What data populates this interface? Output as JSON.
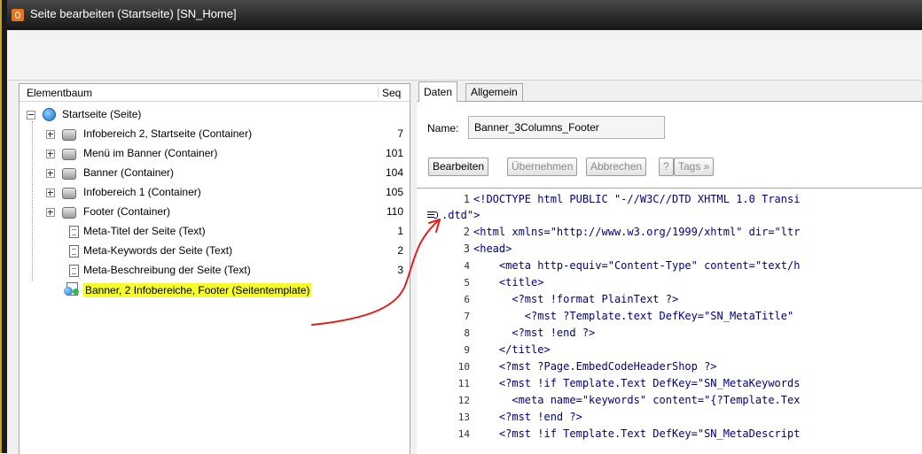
{
  "window": {
    "title": "Seite bearbeiten (Startseite) [SN_Home]"
  },
  "tree": {
    "header_name": "Elementbaum",
    "header_seq": "Seq",
    "root_label": "Startseite (Seite)",
    "items": [
      {
        "label": "Infobereich 2, Startseite (Container)",
        "seq": "7",
        "icon": "container-icon"
      },
      {
        "label": "Menü im Banner (Container)",
        "seq": "101",
        "icon": "container-icon"
      },
      {
        "label": "Banner (Container)",
        "seq": "104",
        "icon": "container-icon"
      },
      {
        "label": "Infobereich 1 (Container)",
        "seq": "105",
        "icon": "container-icon"
      },
      {
        "label": "Footer (Container)",
        "seq": "110",
        "icon": "container-icon"
      },
      {
        "label": "Meta-Titel der Seite (Text)",
        "seq": "1",
        "icon": "text-icon"
      },
      {
        "label": "Meta-Keywords der Seite (Text)",
        "seq": "2",
        "icon": "text-icon"
      },
      {
        "label": "Meta-Beschreibung der Seite (Text)",
        "seq": "3",
        "icon": "text-icon"
      },
      {
        "label": "Banner, 2 Infobereiche, Footer (Seitentemplate)",
        "seq": "",
        "icon": "page-template-icon"
      }
    ],
    "highlight_color": "#f6fb2a"
  },
  "tabs": [
    {
      "label": "Daten"
    },
    {
      "label": "Allgemein"
    }
  ],
  "form": {
    "name_label": "Name:",
    "name_value": "Banner_3Columns_Footer"
  },
  "buttons": {
    "edit": "Bearbeiten",
    "apply": "Übernehmen",
    "cancel": "Abbrechen",
    "help": "?",
    "tags": "Tags »"
  },
  "code": {
    "lines": [
      {
        "n": "1",
        "text": "<!DOCTYPE html PUBLIC \"-//W3C//DTD XHTML 1.0 Transi"
      },
      {
        "n": "",
        "text": ".dtd\">"
      },
      {
        "n": "2",
        "text": "<html xmlns=\"http://www.w3.org/1999/xhtml\" dir=\"ltr"
      },
      {
        "n": "3",
        "text": "<head>"
      },
      {
        "n": "4",
        "text": "    <meta http-equiv=\"Content-Type\" content=\"text/h"
      },
      {
        "n": "5",
        "text": "    <title>"
      },
      {
        "n": "6",
        "text": "      <?mst !format PlainText ?>"
      },
      {
        "n": "7",
        "text": "        <?mst ?Template.text DefKey=\"SN_MetaTitle\" "
      },
      {
        "n": "8",
        "text": "      <?mst !end ?>"
      },
      {
        "n": "9",
        "text": "    </title>"
      },
      {
        "n": "10",
        "text": "    <?mst ?Page.EmbedCodeHeaderShop ?>"
      },
      {
        "n": "11",
        "text": "    <?mst !if Template.Text DefKey=\"SN_MetaKeywords"
      },
      {
        "n": "12",
        "text": "      <meta name=\"keywords\" content=\"{?Template.Tex"
      },
      {
        "n": "13",
        "text": "    <?mst !end ?>"
      },
      {
        "n": "14",
        "text": "    <?mst !if Template.Text DefKey=\"SN_MetaDescript"
      }
    ]
  },
  "annotation": {
    "arrow_color": "#e0201b"
  }
}
